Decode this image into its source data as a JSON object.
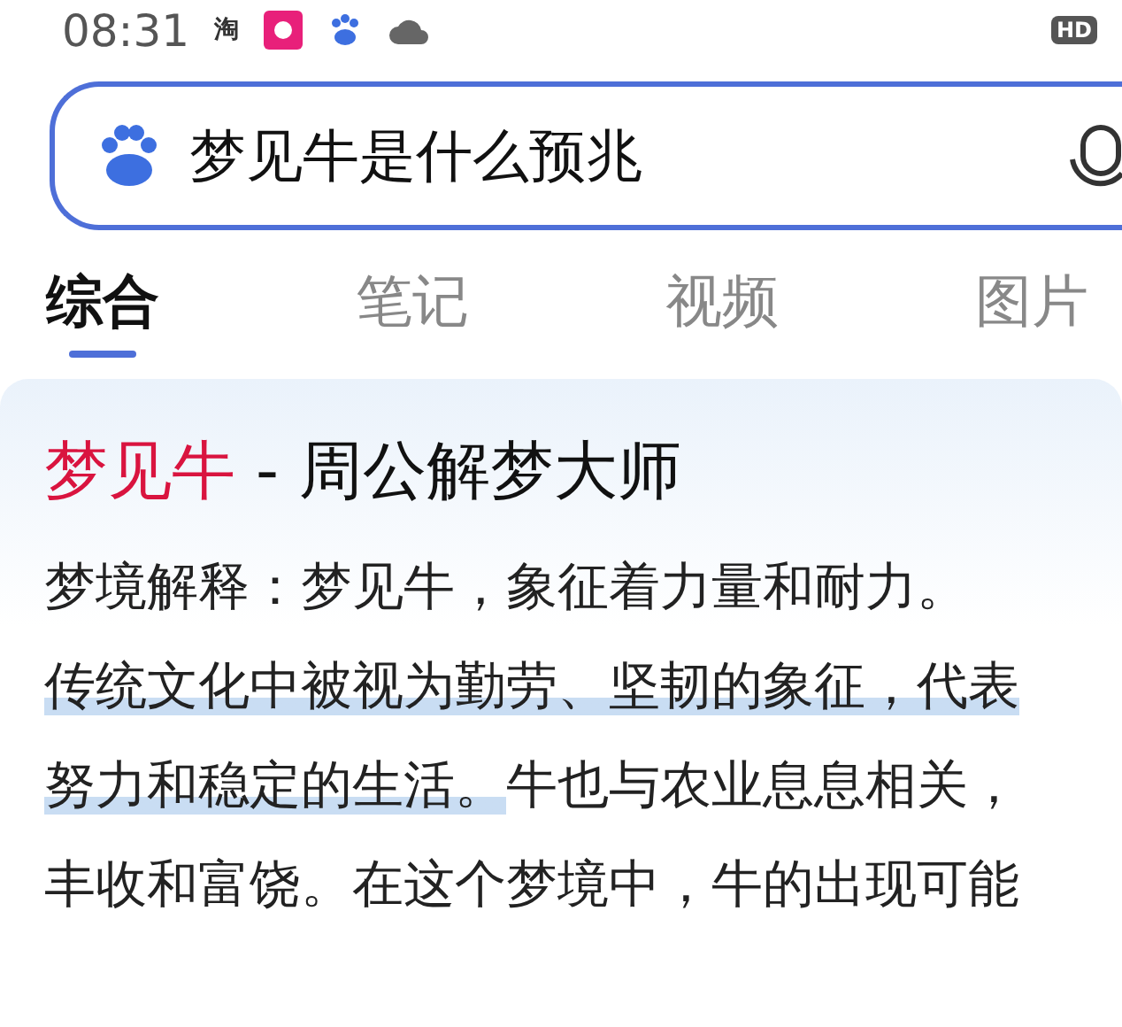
{
  "status_bar": {
    "time": "08:31",
    "app_glyph": "淘",
    "badge": "HD"
  },
  "search": {
    "value": "梦见牛是什么预兆"
  },
  "tabs": [
    {
      "label": "综合",
      "selected": true
    },
    {
      "label": "笔记",
      "selected": false
    },
    {
      "label": "视频",
      "selected": false
    },
    {
      "label": "图片",
      "selected": false
    }
  ],
  "result": {
    "title_keyword": "梦见牛",
    "title_rest": "- 周公解梦大师",
    "lines": [
      [
        {
          "text": "梦境解释：梦见牛，象征着力量和耐力。",
          "highlighted": false
        }
      ],
      [
        {
          "text": "传统文化中被视为勤劳、坚韧的象征，代表",
          "highlighted": true
        }
      ],
      [
        {
          "text": "努力和稳定的生活。",
          "highlighted": true
        },
        {
          "text": "牛也与农业息息相关，",
          "highlighted": false
        }
      ],
      [
        {
          "text": "丰收和富饶。在这个梦境中，牛的出现可能",
          "highlighted": false
        }
      ]
    ]
  }
}
